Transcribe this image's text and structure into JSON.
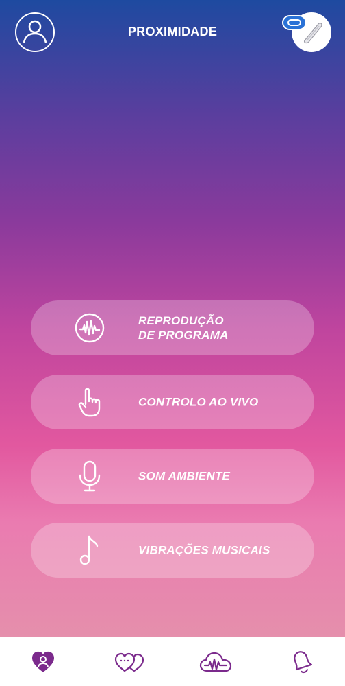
{
  "header": {
    "title": "PROXIMIDADE",
    "profile_icon": "user-circle-icon",
    "device_icon": "toy-device-icon",
    "connection_icon": "connection-pill-icon"
  },
  "menu": {
    "items": [
      {
        "label": "REPRODUÇÃO\nDE PROGRAMA",
        "icon": "waveform-circle-icon"
      },
      {
        "label": "CONTROLO AO VIVO",
        "icon": "hand-pointer-icon"
      },
      {
        "label": "SOM AMBIENTE",
        "icon": "microphone-icon"
      },
      {
        "label": "VIBRAÇÕES MUSICAIS",
        "icon": "music-note-icon"
      }
    ]
  },
  "tabbar": {
    "items": [
      {
        "icon": "heart-person-icon",
        "active": true
      },
      {
        "icon": "hearts-chat-icon",
        "active": false
      },
      {
        "icon": "cloud-wave-icon",
        "active": false
      },
      {
        "icon": "bell-icon",
        "active": false
      }
    ]
  },
  "colors": {
    "gradient_top": "#1e4aa0",
    "gradient_mid": "#c0459e",
    "gradient_bottom": "#e58fac",
    "tab_icon": "#7b2a8c",
    "badge": "#2a72d6"
  }
}
